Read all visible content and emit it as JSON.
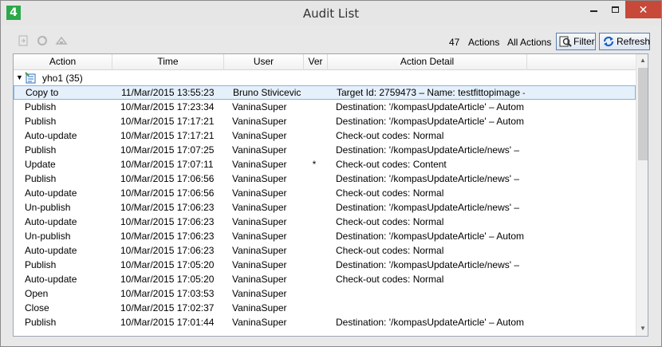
{
  "window": {
    "title": "Audit List",
    "app_icon_text": "4",
    "close_glyph": "✕"
  },
  "toolbar": {
    "count": "47",
    "count_label": "Actions",
    "filter_scope": "All Actions",
    "filter_label": "Filter",
    "refresh_label": "Refresh"
  },
  "grid": {
    "columns": [
      "Action",
      "Time",
      "User",
      "Ver",
      "Action Detail"
    ],
    "group": {
      "label": "yho1 (35)"
    },
    "rows": [
      {
        "action": "Copy to",
        "time": "11/Mar/2015 13:55:23",
        "user": "Bruno Stivicevic",
        "ver": "",
        "detail": "Target Id: 2759473 – Name: testfittopimage –",
        "selected": true
      },
      {
        "action": "Publish",
        "time": "10/Mar/2015 17:23:34",
        "user": "VaninaSuper",
        "ver": "",
        "detail": "Destination: '/kompasUpdateArticle' – Autom"
      },
      {
        "action": "Publish",
        "time": "10/Mar/2015 17:17:21",
        "user": "VaninaSuper",
        "ver": "",
        "detail": "Destination: '/kompasUpdateArticle' – Autom"
      },
      {
        "action": "Auto-update",
        "time": "10/Mar/2015 17:17:21",
        "user": "VaninaSuper",
        "ver": "",
        "detail": "Check-out codes: Normal"
      },
      {
        "action": "Publish",
        "time": "10/Mar/2015 17:07:25",
        "user": "VaninaSuper",
        "ver": "",
        "detail": "Destination: '/kompasUpdateArticle/news' –"
      },
      {
        "action": "Update",
        "time": "10/Mar/2015 17:07:11",
        "user": "VaninaSuper",
        "ver": "*",
        "detail": "Check-out codes: Content"
      },
      {
        "action": "Publish",
        "time": "10/Mar/2015 17:06:56",
        "user": "VaninaSuper",
        "ver": "",
        "detail": "Destination: '/kompasUpdateArticle/news' –"
      },
      {
        "action": "Auto-update",
        "time": "10/Mar/2015 17:06:56",
        "user": "VaninaSuper",
        "ver": "",
        "detail": "Check-out codes: Normal"
      },
      {
        "action": "Un-publish",
        "time": "10/Mar/2015 17:06:23",
        "user": "VaninaSuper",
        "ver": "",
        "detail": "Destination: '/kompasUpdateArticle/news' –"
      },
      {
        "action": "Auto-update",
        "time": "10/Mar/2015 17:06:23",
        "user": "VaninaSuper",
        "ver": "",
        "detail": "Check-out codes: Normal"
      },
      {
        "action": "Un-publish",
        "time": "10/Mar/2015 17:06:23",
        "user": "VaninaSuper",
        "ver": "",
        "detail": "Destination: '/kompasUpdateArticle' – Autom"
      },
      {
        "action": "Auto-update",
        "time": "10/Mar/2015 17:06:23",
        "user": "VaninaSuper",
        "ver": "",
        "detail": "Check-out codes: Normal"
      },
      {
        "action": "Publish",
        "time": "10/Mar/2015 17:05:20",
        "user": "VaninaSuper",
        "ver": "",
        "detail": "Destination: '/kompasUpdateArticle/news' –"
      },
      {
        "action": "Auto-update",
        "time": "10/Mar/2015 17:05:20",
        "user": "VaninaSuper",
        "ver": "",
        "detail": "Check-out codes: Normal"
      },
      {
        "action": "Open",
        "time": "10/Mar/2015 17:03:53",
        "user": "VaninaSuper",
        "ver": "",
        "detail": ""
      },
      {
        "action": "Close",
        "time": "10/Mar/2015 17:02:37",
        "user": "VaninaSuper",
        "ver": "",
        "detail": ""
      },
      {
        "action": "Publish",
        "time": "10/Mar/2015 17:01:44",
        "user": "VaninaSuper",
        "ver": "",
        "detail": "Destination: '/kompasUpdateArticle' – Autom"
      }
    ]
  },
  "colors": {
    "selection_bg": "#e6f0fb",
    "selection_border": "#84b3e2",
    "close_button": "#c7493a",
    "app_icon": "#2da84a"
  }
}
